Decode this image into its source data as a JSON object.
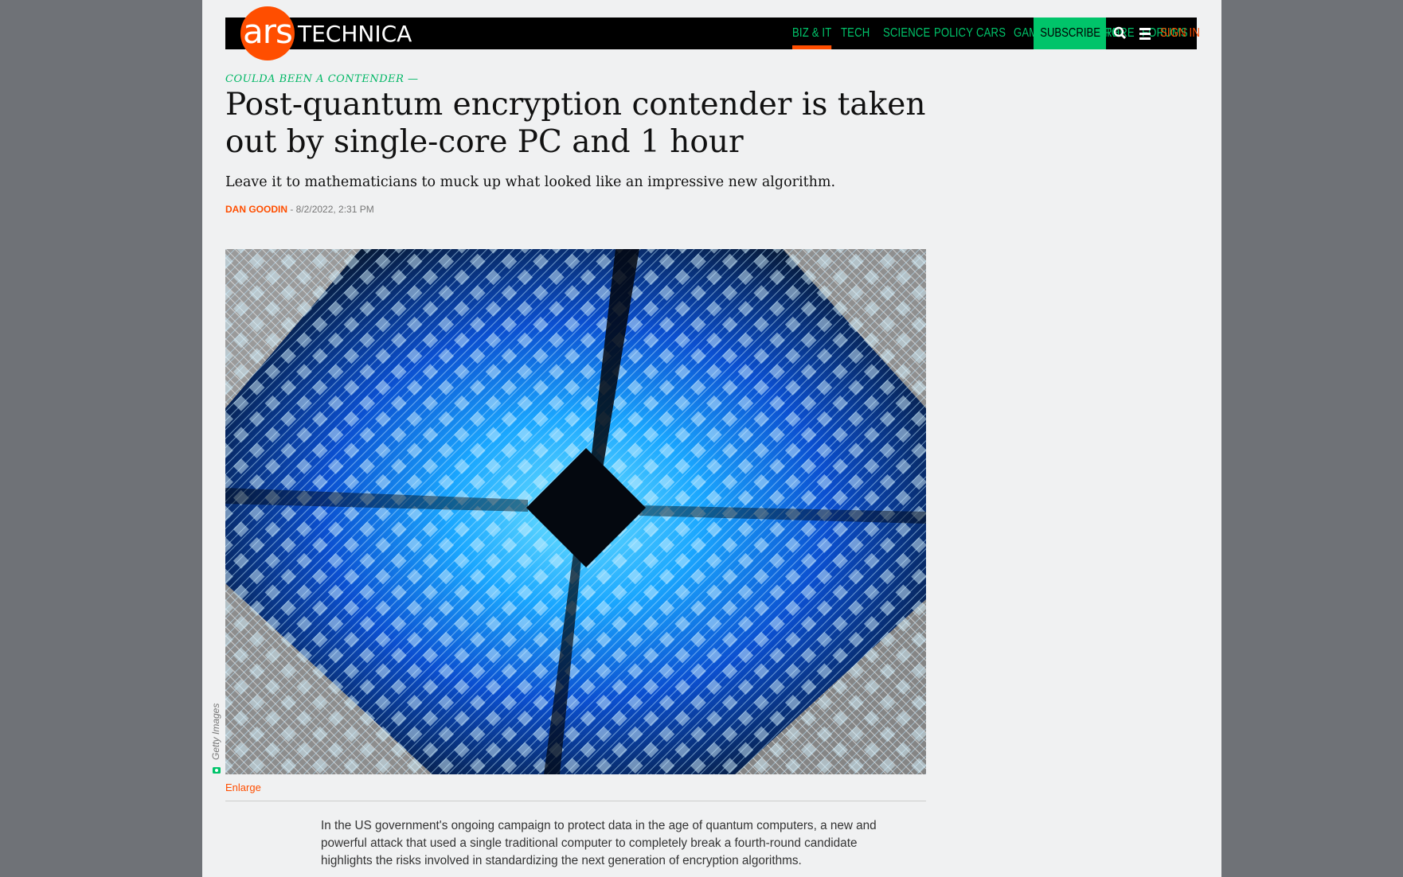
{
  "header": {
    "logo_ars": "ars",
    "logo_name": "TECHNICA",
    "nav": [
      "BIZ & IT",
      "TECH",
      "SCIENCE",
      "POLICY",
      "CARS",
      "GAMING & CULTURE",
      "STORE",
      "FORUMS"
    ],
    "subscribe": "SUBSCRIBE",
    "sign_in": "SIGN IN",
    "search_icon": "search-icon",
    "menu_icon": "menu-icon"
  },
  "article": {
    "kicker": "COULDA BEEN A CONTENDER —",
    "title": "Post-quantum encryption contender is taken out by single-core PC and 1 hour",
    "dek": "Leave it to mathematicians to muck up what looked like an impressive new algorithm.",
    "author": "Dan Goodin",
    "separator": " - ",
    "date": "8/2/2022, 2:31 PM",
    "image_credit": "Getty Images",
    "enlarge": "Enlarge",
    "body": "In the US government's ongoing campaign to protect data in the age of quantum computers, a new and powerful attack that used a single traditional computer to completely break a fourth-round candidate highlights the risks involved in standardizing the next generation of encryption algorithms."
  },
  "colors": {
    "accent": "#ff4e00",
    "green": "#00c46a",
    "background": "#f0f1f2",
    "outer": "#6f7277"
  }
}
